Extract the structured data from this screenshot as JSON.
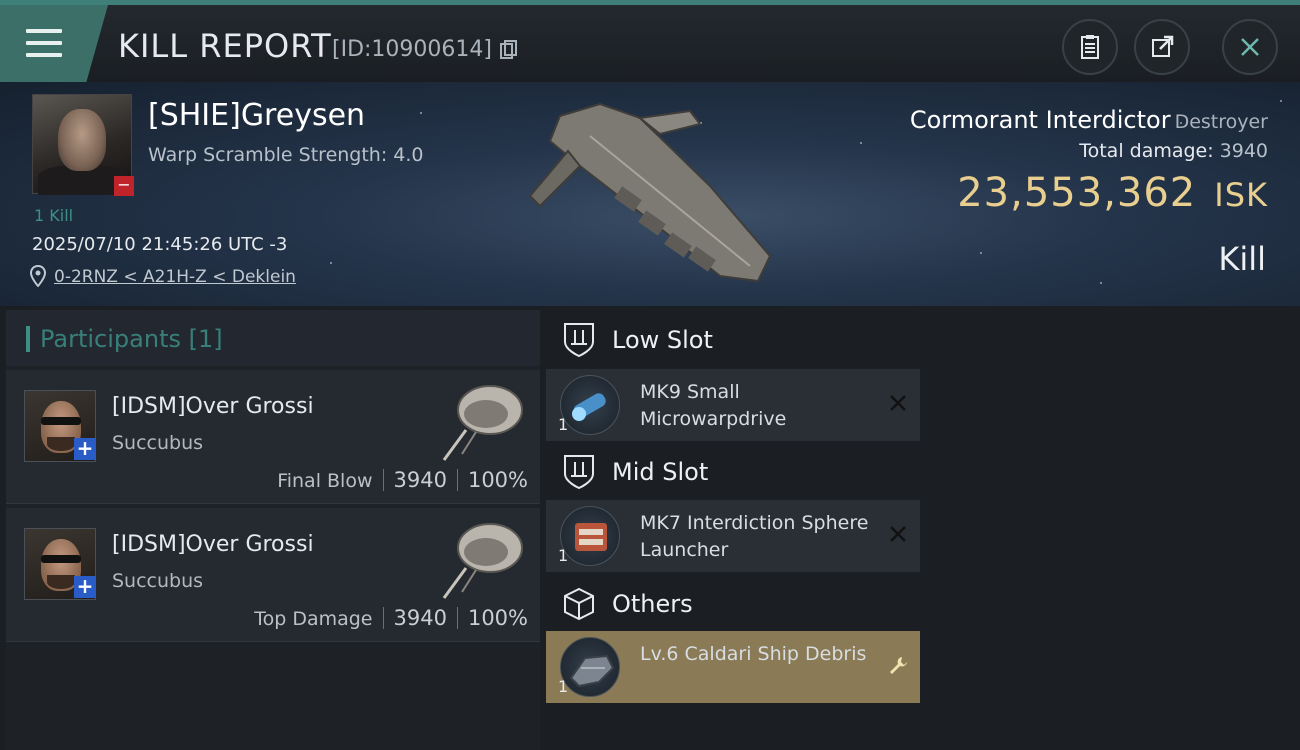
{
  "header": {
    "title": "KILL REPORT",
    "report_id": "[ID:10900614]"
  },
  "victim": {
    "name": "[SHIE]Greysen",
    "scramble": "Warp Scramble Strength: 4.0",
    "kill_count": "1 Kill",
    "timestamp": "2025/07/10 21:45:26 UTC -3",
    "location": "0-2RNZ < A21H-Z < Deklein",
    "ship_name": "Cormorant Interdictor",
    "ship_class": "Destroyer",
    "total_damage_label": "Total damage:",
    "total_damage": "3940",
    "isk_value": "23,553,362",
    "isk_unit": "ISK",
    "result": "Kill"
  },
  "participants": {
    "title": "Participants [1]",
    "rows": [
      {
        "name": "[IDSM]Over Grossi",
        "ship": "Succubus",
        "label": "Final Blow",
        "damage": "3940",
        "percent": "100%"
      },
      {
        "name": "[IDSM]Over Grossi",
        "ship": "Succubus",
        "label": "Top Damage",
        "damage": "3940",
        "percent": "100%"
      }
    ]
  },
  "slots": {
    "low": {
      "title": "Low Slot",
      "item": {
        "qty": "1",
        "name": "MK9 Small Microwarpdrive"
      }
    },
    "mid": {
      "title": "Mid Slot",
      "item": {
        "qty": "1",
        "name": "MK7 Interdiction Sphere Launcher"
      }
    },
    "others": {
      "title": "Others",
      "item": {
        "qty": "1",
        "name": "Lv.6 Caldari Ship Debris"
      }
    }
  },
  "colors": {
    "accent": "#3e8f86",
    "isk": "#e9cf8f",
    "highlight_item": "#8a7a55",
    "minus_badge": "#c0242a",
    "plus_badge": "#2a5cc8"
  }
}
